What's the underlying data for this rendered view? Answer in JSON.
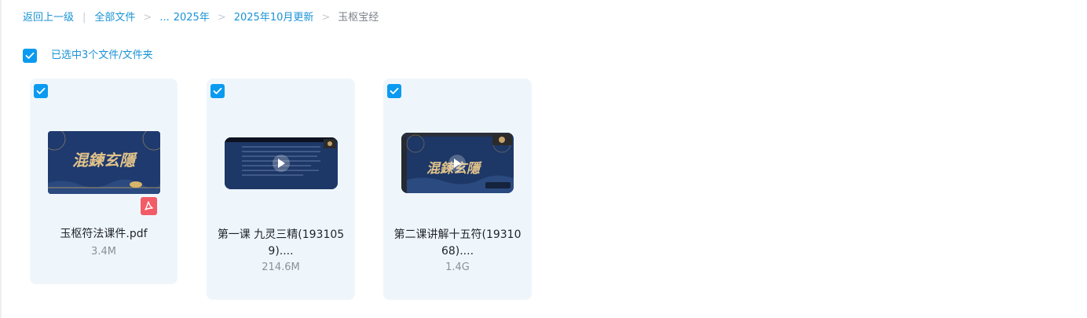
{
  "breadcrumb": {
    "back": "返回上一级",
    "all_files": "全部文件",
    "ellipsis": "...",
    "year": "2025年",
    "month": "2025年10月更新",
    "current": "玉枢宝经",
    "separator": ">",
    "pipe": "|"
  },
  "selection": {
    "label": "已选中3个文件/文件夹"
  },
  "files": [
    {
      "name": "玉枢符法课件.pdf",
      "size": "3.4M",
      "type": "pdf",
      "thumb_title": "混鍊玄隱"
    },
    {
      "name_line1": "第一课 九灵三精(193105",
      "name_line2": "9)....",
      "size": "214.6M",
      "type": "video"
    },
    {
      "name_line1": "第二课讲解十五符(19310",
      "name_line2": "68)....",
      "size": "1.4G",
      "type": "video",
      "thumb_title": "混鍊玄隱"
    }
  ],
  "colors": {
    "accent": "#0a9bf0",
    "link": "#1a93d6",
    "card_bg": "#eff6fb",
    "pdf_badge": "#f25c66"
  },
  "icons": {
    "checkbox": "check-icon",
    "pdf": "pdf-icon",
    "play": "play-icon"
  }
}
